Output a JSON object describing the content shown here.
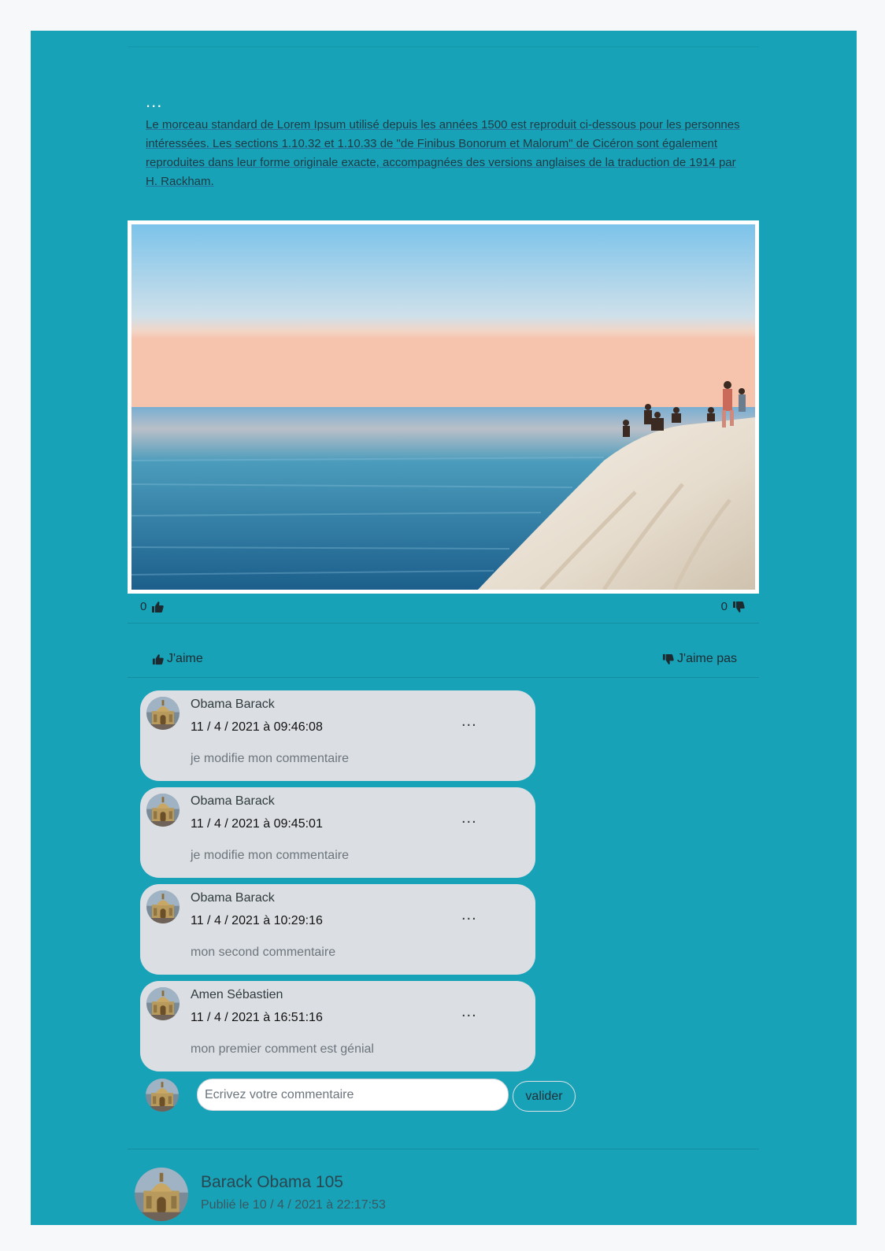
{
  "post": {
    "menu_label": "...",
    "text": "Le morceau standard de Lorem Ipsum utilisé depuis les années 1500 est reproduit ci-dessous pour les personnes intéressées. Les sections 1.10.32 et 1.10.33 de \"de Finibus Bonorum et Malorum\" de Cicéron sont également reproduites dans leur forme originale exacte, accompagnées des versions anglaises de la traduction de 1914 par H. Rackham.",
    "likes_count": "0",
    "dislikes_count": "0",
    "like_label": "J'aime",
    "dislike_label": "J'aime pas"
  },
  "comments": [
    {
      "author": "Obama Barack",
      "date": "11 / 4 / 2021 à 09:46:08",
      "text": "je modifie mon commentaire",
      "menu_label": "..."
    },
    {
      "author": "Obama Barack",
      "date": "11 / 4 / 2021 à 09:45:01",
      "text": "je modifie mon commentaire",
      "menu_label": "..."
    },
    {
      "author": "Obama Barack",
      "date": "11 / 4 / 2021 à 10:29:16",
      "text": "mon second commentaire",
      "menu_label": "..."
    },
    {
      "author": "Amen Sébastien",
      "date": "11 / 4 / 2021 à 16:51:16",
      "text": "mon premier comment est génial",
      "menu_label": "..."
    }
  ],
  "new_comment": {
    "placeholder": "Ecrivez votre commentaire",
    "submit_label": "valider"
  },
  "next_post": {
    "author": "Barack Obama 105",
    "date": "Publié le 10 / 4 / 2021 à 22:17:53"
  },
  "colors": {
    "page_background": "#17a2b8",
    "comment_bubble": "#dbdee2"
  }
}
